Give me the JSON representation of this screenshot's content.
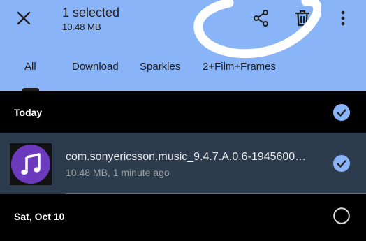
{
  "selection_bar": {
    "title": "1 selected",
    "size": "10.48 MB",
    "close_icon": "close-icon",
    "share_icon": "share-icon",
    "delete_icon": "trash-icon",
    "more_icon": "more-vert-icon"
  },
  "tabs": [
    {
      "label": "All",
      "selected": true
    },
    {
      "label": "Download",
      "selected": false
    },
    {
      "label": "Sparkles",
      "selected": false
    },
    {
      "label": "2+Film+Frames",
      "selected": false
    }
  ],
  "sections": [
    {
      "label": "Today",
      "checked": true,
      "files": [
        {
          "name": "com.sonyericsson.music_9.4.7.A.0.6-1945600…",
          "meta": "10.48 MB, 1 minute ago",
          "icon": "music-note-icon",
          "checked": true
        }
      ]
    },
    {
      "label": "Sat, Oct 10",
      "checked": false,
      "files": []
    }
  ],
  "colors": {
    "app_bar": "#8ab4f8",
    "background": "#000000",
    "selected_row": "#2d3c4c",
    "check_accent": "#8ab4f8",
    "music_icon_bg": "#6c3bbd",
    "scribble": "#ffffff"
  }
}
